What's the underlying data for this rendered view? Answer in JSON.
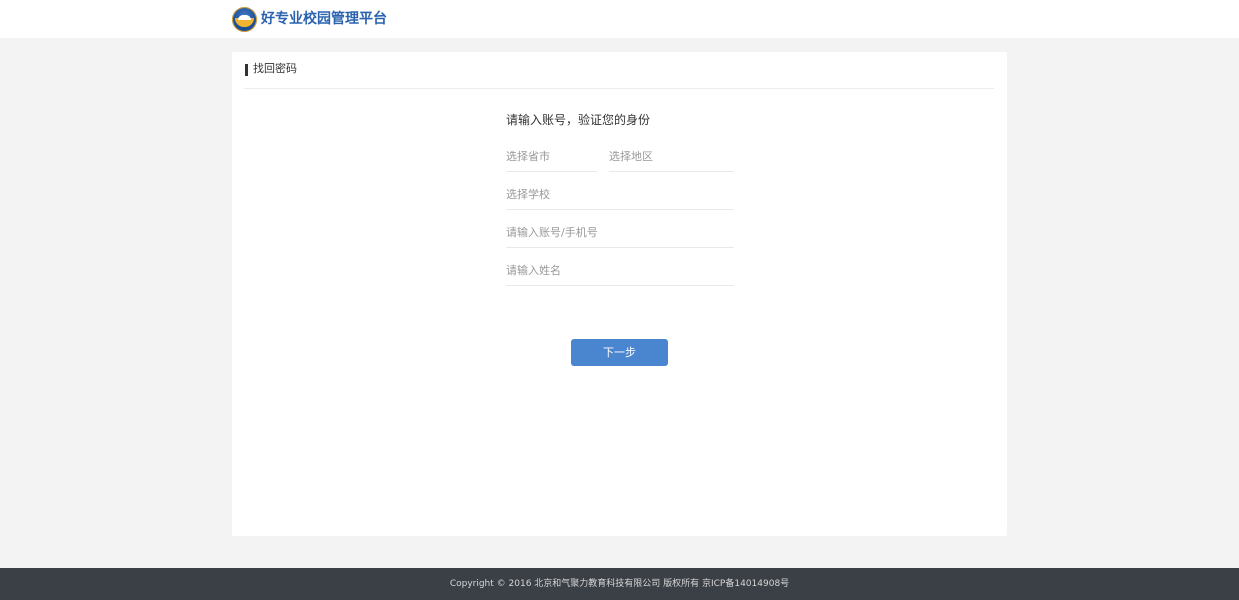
{
  "header": {
    "brand_title": "好专业校园管理平台",
    "logo_icon": "school-emblem-logo"
  },
  "card": {
    "title": "找回密码"
  },
  "form": {
    "heading": "请输入账号，验证您的身份",
    "province_placeholder": "选择省市",
    "district_placeholder": "选择地区",
    "school_placeholder": "选择学校",
    "account_placeholder": "请输入账号/手机号",
    "name_placeholder": "请输入姓名",
    "next_label": "下一步"
  },
  "footer": {
    "copyright": "Copyright © 2016 北京和气聚力教育科技有限公司 版权所有 京ICP备14014908号"
  },
  "colors": {
    "brand_blue": "#2a62b0",
    "button_blue": "#4a86d0",
    "footer_bg": "#3b3f46",
    "page_bg": "#f3f3f3"
  }
}
